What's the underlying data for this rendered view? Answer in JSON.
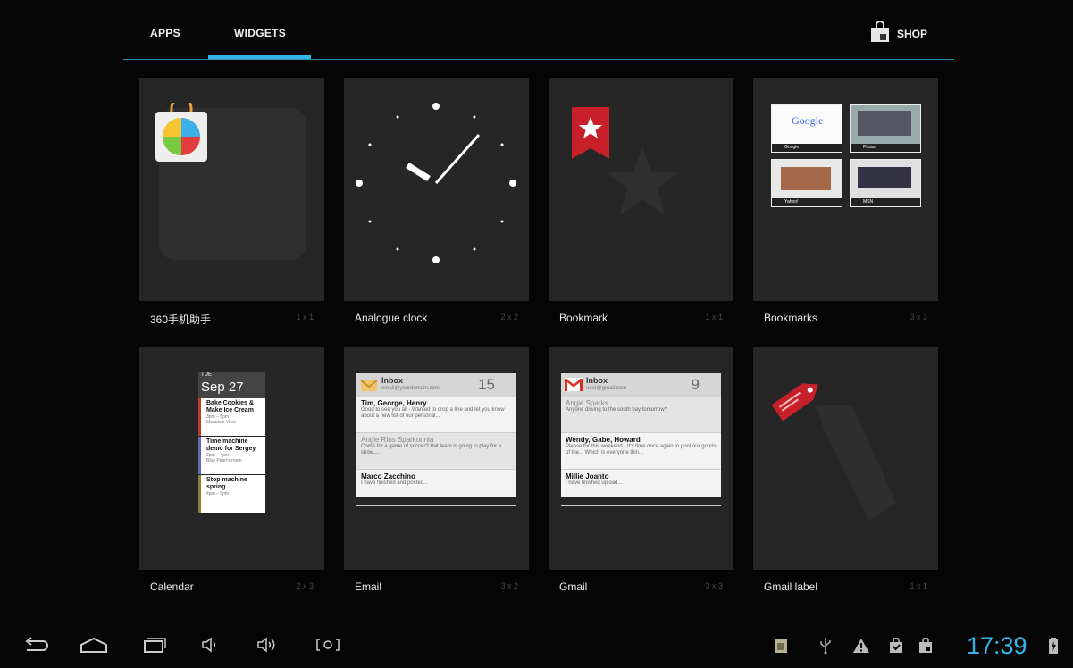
{
  "tabs": [
    {
      "label": "APPS",
      "active": false
    },
    {
      "label": "WIDGETS",
      "active": true
    }
  ],
  "shop": {
    "label": "SHOP",
    "icon": "shopping-bag-icon"
  },
  "widgets": [
    {
      "name": "360手机助手",
      "size": "1 x 1"
    },
    {
      "name": "Analogue clock",
      "size": "2 x 2"
    },
    {
      "name": "Bookmark",
      "size": "1 x 1"
    },
    {
      "name": "Bookmarks",
      "size": "3 x 3"
    },
    {
      "name": "Calendar",
      "size": "2 x 3"
    },
    {
      "name": "Email",
      "size": "3 x 2"
    },
    {
      "name": "Gmail",
      "size": "3 x 3"
    },
    {
      "name": "Gmail label",
      "size": "1 x 1"
    }
  ],
  "previews": {
    "bookmarks": [
      "Google",
      "Picasa",
      "Yahoo!",
      "MSN"
    ],
    "calendar": {
      "dow": "TUE",
      "date": "Sep 27",
      "events": [
        {
          "title": "Bake Cookies & Make Ice Cream",
          "time": "3pm – 5pm",
          "place": "Mountain View",
          "color": "#c0392b"
        },
        {
          "title": "Time machine demo for Sergey",
          "time": "3pm – 4pm",
          "place": "Blue Peter's room",
          "color": "#5b6abf"
        },
        {
          "title": "Stop machine spring",
          "time": "4pm – 5pm",
          "place": "",
          "color": "#8a7f3a"
        }
      ]
    },
    "email": {
      "title": "Inbox",
      "account": "email@yourdomain.com",
      "count": "15",
      "rows": [
        {
          "from": "Tim, George, Henry",
          "snippet": "Good to see you all - Wanted to drop a line and let you know about a new list of our personal...",
          "read": false
        },
        {
          "from": "Angie Rios Sparkonnia",
          "snippet": "Come for a game of soccer? Hat team is going to play for a show....",
          "read": true
        },
        {
          "from": "Marco Zacchino",
          "snippet": "I have finished and posted...",
          "read": false
        }
      ]
    },
    "gmail": {
      "title": "Inbox",
      "account": "user@gmail.com",
      "count": "9",
      "rows": [
        {
          "from": "Angie Sparks",
          "snippet": "Anyone driving to the south bay tomorrow?",
          "read": true
        },
        {
          "from": "Wendy, Gabe, Howard",
          "snippet": "Please for this weekend - It's time once again to pool our goods of the... Which is everyone thin...",
          "read": false
        },
        {
          "from": "Millie Joanto",
          "snippet": "I have finished upload...",
          "read": false
        }
      ]
    }
  },
  "navbar": [
    "back-icon",
    "home-icon",
    "recent-apps-icon",
    "volume-down-icon",
    "volume-up-icon",
    "screenshot-icon"
  ],
  "status": {
    "time": "17:39",
    "icons": [
      "app-notification-icon",
      "usb-icon",
      "warning-icon",
      "download-icon",
      "shop-notification-icon",
      "battery-icon"
    ]
  },
  "colors": {
    "accent": "#33b5e5",
    "background": "#050505",
    "card": "#262626"
  }
}
